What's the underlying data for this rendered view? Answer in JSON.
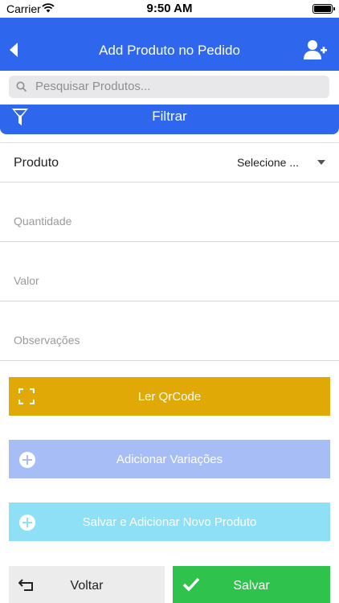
{
  "status_bar": {
    "carrier": "Carrier",
    "time": "9:50 AM"
  },
  "navbar": {
    "title": "Add Produto no Pedido",
    "back_icon": "chevron-left-icon",
    "action_icon": "add-user-icon"
  },
  "search": {
    "placeholder": "Pesquisar Produtos..."
  },
  "filter": {
    "label": "Filtrar",
    "icon": "funnel-icon"
  },
  "form": {
    "produto_label": "Produto",
    "produto_value": "Selecione ...",
    "quantidade_placeholder": "Quantidade",
    "valor_placeholder": "Valor",
    "observacoes_placeholder": "Observações"
  },
  "buttons": {
    "qrcode": "Ler QrCode",
    "variacoes": "Adicionar Variações",
    "salvar_novo": "Salvar e Adicionar Novo Produto",
    "voltar": "Voltar",
    "salvar": "Salvar"
  },
  "colors": {
    "primary": "#2f66ee",
    "qrcode": "#e0a905",
    "variacoes": "#a7bdf6",
    "salvar_novo": "#8ee0f7",
    "salvar": "#2fc24c",
    "voltar": "#ececec"
  }
}
